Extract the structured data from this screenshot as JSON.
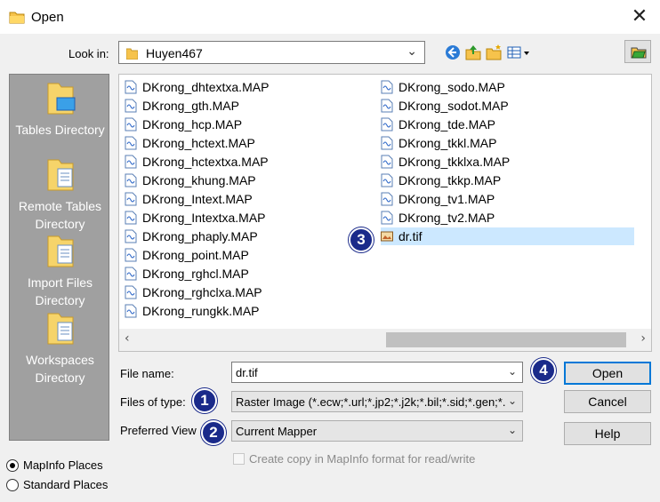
{
  "window": {
    "title": "Open",
    "close_glyph": "✕"
  },
  "lookin": {
    "label": "Look in:",
    "value": "Huyen467"
  },
  "toolbar": {
    "icons": [
      "back-icon",
      "up-folder-icon",
      "new-folder-icon",
      "view-menu-icon"
    ],
    "extra_icon": "folder-browse-icon"
  },
  "places": [
    {
      "label": "Tables Directory"
    },
    {
      "label": "Remote Tables Directory"
    },
    {
      "label": "Import Files Directory"
    },
    {
      "label": "Workspaces Directory"
    }
  ],
  "files_col1": [
    "DKrong_dhtextxa.MAP",
    "DKrong_gth.MAP",
    "DKrong_hcp.MAP",
    "DKrong_hctext.MAP",
    "DKrong_hctextxa.MAP",
    "DKrong_khung.MAP",
    "DKrong_Intext.MAP",
    "DKrong_Intextxa.MAP",
    "DKrong_phaply.MAP",
    "DKrong_point.MAP",
    "DKrong_rghcl.MAP",
    "DKrong_rghclxa.MAP",
    "DKrong_rungkk.MAP"
  ],
  "files_col2": [
    "DKrong_sodo.MAP",
    "DKrong_sodot.MAP",
    "DKrong_tde.MAP",
    "DKrong_tkkl.MAP",
    "DKrong_tkklxa.MAP",
    "DKrong_tkkp.MAP",
    "DKrong_tv1.MAP",
    "DKrong_tv2.MAP",
    "dr.tif"
  ],
  "selected_file": "dr.tif",
  "scroll": {
    "left": "‹",
    "right": "›"
  },
  "form": {
    "filename_label": "File name:",
    "filename_value": "dr.tif",
    "filetype_label": "Files of type:",
    "filetype_value": "Raster Image (*.ecw;*.url;*.jp2;*.j2k;*.bil;*.sid;*.gen;*.",
    "view_label": "Preferred View",
    "view_value": "Current Mapper"
  },
  "buttons": {
    "open": "Open",
    "cancel": "Cancel",
    "help": "Help"
  },
  "checkbox": {
    "label": "Create copy in MapInfo format for read/write",
    "checked": false,
    "enabled": false
  },
  "radios": [
    {
      "label": "MapInfo Places",
      "selected": true
    },
    {
      "label": "Standard Places",
      "selected": false
    }
  ],
  "badges": [
    "1",
    "2",
    "3",
    "4"
  ],
  "colors": {
    "badge": "#1a2a8a",
    "selection": "#cce8ff",
    "places_bg": "#a0a0a0",
    "accent": "#0078d7"
  }
}
